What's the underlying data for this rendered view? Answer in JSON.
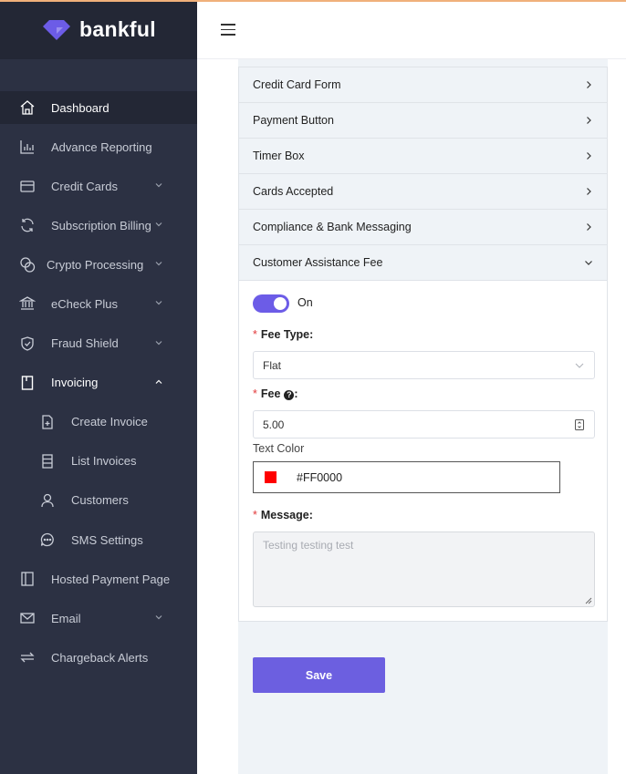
{
  "brand": {
    "name": "bankful",
    "color": "#6c5ce7"
  },
  "sidebar": {
    "items": [
      {
        "label": "Dashboard",
        "icon": "home-icon",
        "active": true
      },
      {
        "label": "Advance Reporting",
        "icon": "bar-chart-icon"
      },
      {
        "label": "Credit Cards",
        "icon": "credit-card-icon",
        "chevron": "down"
      },
      {
        "label": "Subscription Billing",
        "icon": "refresh-icon",
        "chevron": "down"
      },
      {
        "label": "Crypto Processing",
        "icon": "coins-icon",
        "chevron": "down"
      },
      {
        "label": "eCheck Plus",
        "icon": "bank-icon",
        "chevron": "down"
      },
      {
        "label": "Fraud Shield",
        "icon": "shield-icon",
        "chevron": "down"
      },
      {
        "label": "Invoicing",
        "icon": "bookmark-icon",
        "chevron": "up",
        "open": true
      },
      {
        "label": "Create Invoice",
        "icon": "file-plus-icon",
        "sub": true
      },
      {
        "label": "List Invoices",
        "icon": "list-icon",
        "sub": true
      },
      {
        "label": "Customers",
        "icon": "user-icon",
        "sub": true
      },
      {
        "label": "SMS Settings",
        "icon": "chat-icon",
        "sub": true
      },
      {
        "label": "Hosted Payment Page",
        "icon": "layout-icon"
      },
      {
        "label": "Email",
        "icon": "mail-icon",
        "chevron": "down"
      },
      {
        "label": "Chargeback Alerts",
        "icon": "swap-icon"
      }
    ]
  },
  "accordion": {
    "sections": [
      {
        "label": "Credit Card Form"
      },
      {
        "label": "Payment Button"
      },
      {
        "label": "Timer Box"
      },
      {
        "label": "Cards Accepted"
      },
      {
        "label": "Compliance & Bank Messaging"
      }
    ],
    "open_section": {
      "label": "Customer Assistance Fee",
      "toggle_label": "On",
      "fee_type_label": "Fee Type",
      "fee_type_value": "Flat",
      "fee_label": "Fee",
      "fee_value": "5.00",
      "text_color_label": "Text Color",
      "text_color_value": "#FF0000",
      "swatch_color": "#ff0000",
      "message_label": "Message",
      "message_placeholder": "Testing testing test"
    }
  },
  "actions": {
    "save_label": "Save"
  }
}
